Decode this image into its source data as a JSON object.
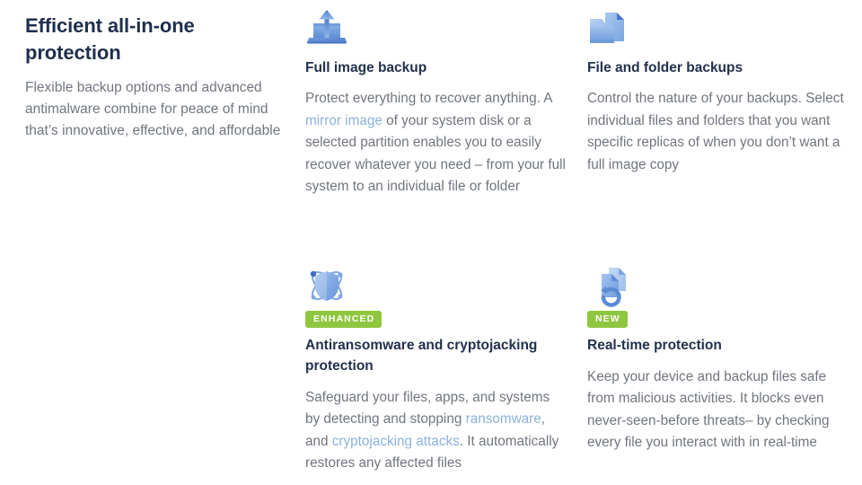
{
  "intro": {
    "title": "Efficient all-in-one protection",
    "body": "Flexible backup options and advanced antimalware combine for peace of mind that’s innovative, effective, and affordable"
  },
  "colors": {
    "heading": "#1e2f4d",
    "body_text": "#70757e",
    "link": "#8ab2de",
    "badge_green": "#8fc63f",
    "icon_blue_dark": "#4a76c4",
    "icon_blue_mid": "#7aa4e0",
    "icon_blue_light": "#a9c8ef",
    "background": "#ffffff"
  },
  "cards": [
    {
      "id": "full-image-backup",
      "icon": "laptop-upload-icon",
      "badge": null,
      "title": "Full image backup",
      "body_parts": [
        {
          "type": "text",
          "text": "Protect everything to recover anything. A "
        },
        {
          "type": "link",
          "text": "mirror image"
        },
        {
          "type": "text",
          "text": " of your system disk or a selected partition enables you to easily recover whatever you need – from your full system to an individual file or folder"
        }
      ]
    },
    {
      "id": "file-and-folder-backups",
      "icon": "folder-document-icon",
      "badge": null,
      "title": "File and folder backups",
      "body_parts": [
        {
          "type": "text",
          "text": "Control the nature of your backups. Select individual files and folders that you want specific replicas of when you don’t want a full image copy"
        }
      ]
    },
    {
      "id": "antiransomware-and-cryptojacking-protection",
      "icon": "shield-atom-icon",
      "badge": "ENHANCED",
      "title": "Antiransomware and cryptojacking protection",
      "body_parts": [
        {
          "type": "text",
          "text": "Safeguard your files, apps, and systems by detecting and stopping "
        },
        {
          "type": "link",
          "text": "ransomware"
        },
        {
          "type": "text",
          "text": ", and "
        },
        {
          "type": "link",
          "text": "cryptojacking attacks"
        },
        {
          "type": "text",
          "text": ". It automatically restores any affected files"
        }
      ]
    },
    {
      "id": "real-time-protection",
      "icon": "refresh-documents-icon",
      "badge": "NEW",
      "title": "Real-time protection",
      "body_parts": [
        {
          "type": "text",
          "text": "Keep your device and backup files safe from malicious activities. It blocks even never-seen-before threats– by checking every file you interact with in real-time"
        }
      ]
    }
  ]
}
